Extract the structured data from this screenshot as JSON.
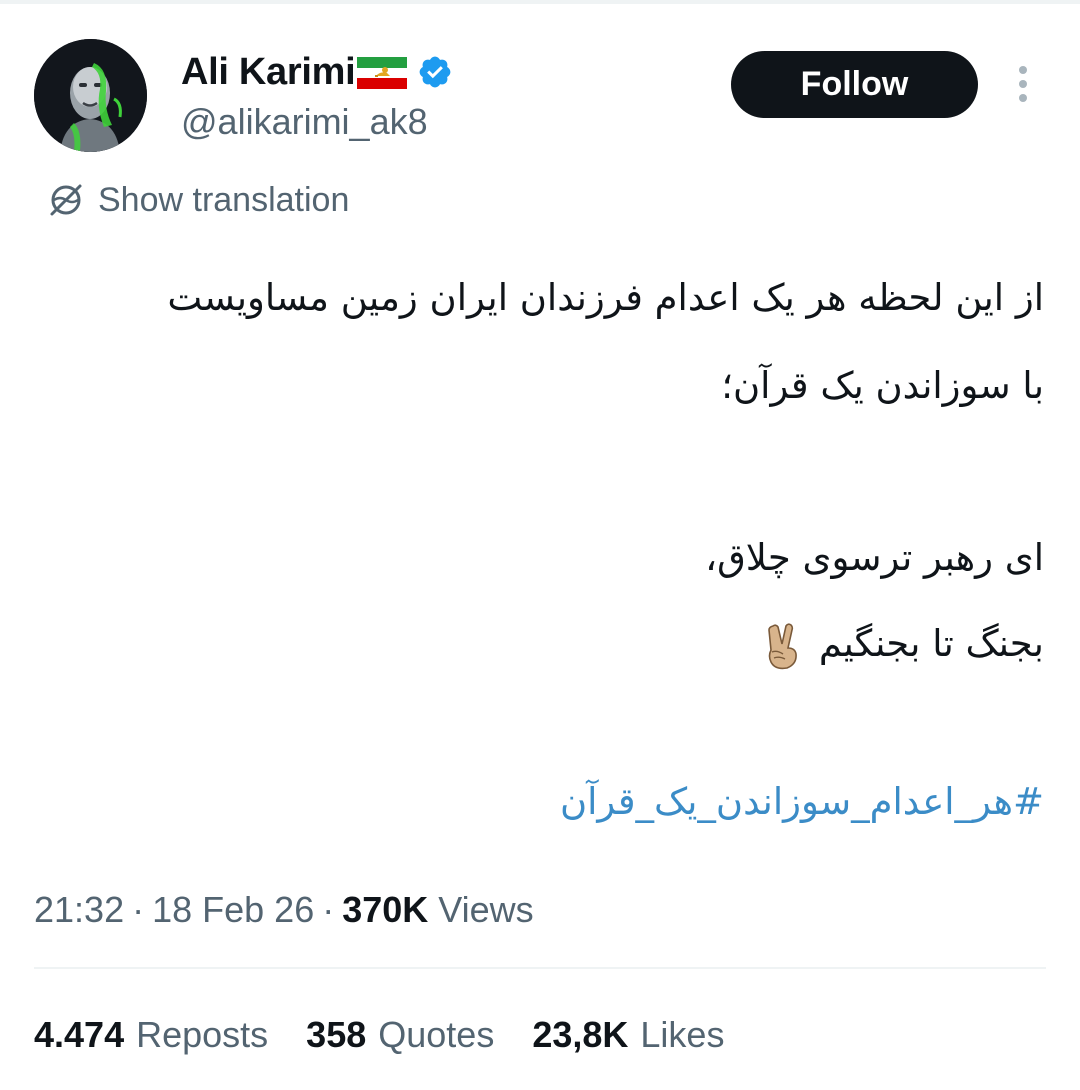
{
  "author": {
    "display_name": "Ali Karimi",
    "handle": "@alikarimi_ak8",
    "avatar": "avatar",
    "badges": [
      "iran-lion-and-sun-flag-icon",
      "verified-badge-icon"
    ]
  },
  "actions": {
    "follow_label": "Follow",
    "more_icon": "more-vertical-icon"
  },
  "translation": {
    "icon": "translate-icon",
    "label": "Show translation"
  },
  "tweet": {
    "lines": [
      "از این لحظه هر یک اعدام فرزندان ایران زمین مساویست",
      "با سوزاندن یک قرآن؛",
      "ای رهبر ترسوی چلاق،",
      "بجنگ تا بجنگیم"
    ],
    "emoji": "victory-hand-icon",
    "hashtag": "#هر_اعدام_سوزاندن_یک_قرآن"
  },
  "meta": {
    "time": "21:32",
    "separator": "·",
    "date": "18 Feb 26",
    "views_count": "370K",
    "views_label": "Views"
  },
  "stats": {
    "reposts_count": "4.474",
    "reposts_label": "Reposts",
    "quotes_count": "358",
    "quotes_label": "Quotes",
    "likes_count": "23,8K",
    "likes_label": "Likes"
  },
  "colors": {
    "text_primary": "#0f1419",
    "text_secondary": "#536471",
    "link": "#3b8cc7",
    "verified": "#1d9bf0",
    "follow_bg": "#0f1419",
    "divider": "#eff3f4"
  }
}
